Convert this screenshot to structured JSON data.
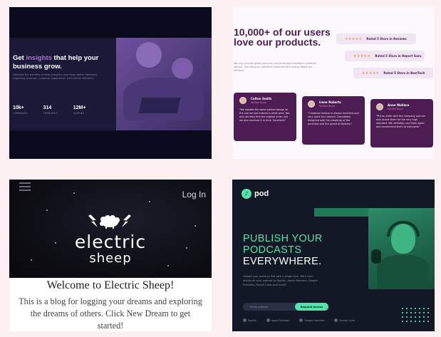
{
  "card1": {
    "title_prefix": "Get ",
    "title_highlight": "insights",
    "title_suffix": " that help your business grow.",
    "description": "Discover the benefits of data analytics and make better decisions regarding revenue, customer experience, and overall efficiency.",
    "stats": [
      {
        "value": "10k+",
        "label": "COMPANIES"
      },
      {
        "value": "314",
        "label": "TEMPLATES"
      },
      {
        "value": "12M+",
        "label": "QUERIES"
      }
    ]
  },
  "card2": {
    "title": "10,000+ of our users love our products.",
    "subtitle": "We only provide great products combined with excellent customer service. See what our satisfied customers are saying about our services.",
    "ratings": [
      {
        "stars": "★★★★★",
        "text": "Rated 5 Stars in Reviews"
      },
      {
        "stars": "★★★★★",
        "text": "Rated 5 Stars in Report Guru"
      },
      {
        "stars": "★★★★★",
        "text": "Rated 5 Stars in BestTech"
      }
    ],
    "reviews": [
      {
        "name": "Colton Smith",
        "verified": "Verified Buyer",
        "quote": "\"We needed the same printed design as the one we had ordered a week prior. Not only did they find the original order, but we also received it in time. Excellent!\""
      },
      {
        "name": "Irene Roberts",
        "verified": "Verified Buyer",
        "quote": "\"Customer service is always excellent and very quick turn around. Completely delighted with the simplicity of the purchase and the speed of delivery.\""
      },
      {
        "name": "Anne Wallace",
        "verified": "Verified Buyer",
        "quote": "\"Put an order with this company and can only praise them for the very high standard. Will definitely use them again and recommend them to everyone!\""
      }
    ]
  },
  "card3": {
    "login": "Log In",
    "brand_line1": "electric",
    "brand_line2": "sheep",
    "welcome": "Welcome to Electric Sheep!",
    "intro": "This is a blog for logging your dreams and exploring the dreams of others. Click New Dream to get started!"
  },
  "card4": {
    "logo": "pod",
    "headline_line1": "PUBLISH YOUR",
    "headline_line2": "PODCASTS",
    "headline_line3": "EVERYWHERE.",
    "description": "Upload your audio to Pod with a single click. We'll then distribute your podcast to Spotify, Apple Podcasts, Google Podcasts, Pocket Casts and more!",
    "email_placeholder": "Email address",
    "cta": "Request access",
    "platforms": [
      "Spotify",
      "Apple Podcasts",
      "Google Podcasts",
      "Pocket Casts"
    ]
  },
  "colors": {
    "page_bg": "#fdf0f3",
    "insights_accent": "#b06bdc",
    "testimonial_purple": "#4d1c52",
    "pod_green": "#52e3a8",
    "pod_navy": "#131826"
  }
}
